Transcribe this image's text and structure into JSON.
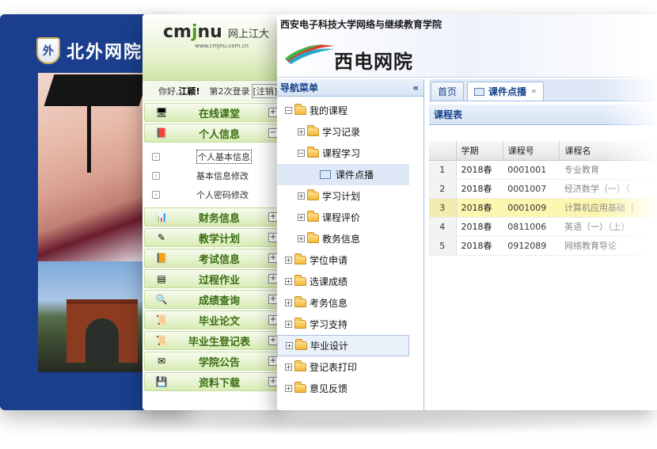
{
  "bfsu": {
    "brand": "北外网院",
    "emblem": "外"
  },
  "cmjnu": {
    "logo_pre": "cm",
    "logo_j": "j",
    "logo_post": "nu",
    "tagline": "网上江大",
    "url": "www.cmjnu.com.cn",
    "welcome_prefix": "你好,",
    "user_name": "江颖!",
    "login_count": "第2次登录",
    "logout": "[注销]",
    "menu": [
      {
        "label": "在线课堂",
        "icon": "monitor-icon",
        "toggle": "+"
      },
      {
        "label": "个人信息",
        "icon": "book-icon",
        "toggle": "−"
      },
      {
        "label": "财务信息",
        "icon": "bar-chart-icon",
        "toggle": "+"
      },
      {
        "label": "教学计划",
        "icon": "pencil-icon",
        "toggle": "+"
      },
      {
        "label": "考试信息",
        "icon": "notebook-icon",
        "toggle": "+"
      },
      {
        "label": "过程作业",
        "icon": "table-icon",
        "toggle": "+"
      },
      {
        "label": "成绩查询",
        "icon": "magnifier-icon",
        "toggle": "+"
      },
      {
        "label": "毕业论文",
        "icon": "scroll-icon",
        "toggle": "+"
      },
      {
        "label": "毕业生登记表",
        "icon": "scroll-icon",
        "toggle": "+"
      },
      {
        "label": "学院公告",
        "icon": "mail-icon",
        "toggle": "+"
      },
      {
        "label": "资料下载",
        "icon": "floppy-icon",
        "toggle": "+"
      }
    ],
    "submenu": [
      "个人基本信息",
      "基本信息修改",
      "个人密码修改"
    ]
  },
  "xidian": {
    "school": "西安电子科技大学网络与继续教育学院",
    "name": "西电网院",
    "nav_title": "导航菜单",
    "collapse": "«",
    "tree": [
      {
        "label": "我的课程",
        "level": 0,
        "toggle": "−",
        "type": "folder"
      },
      {
        "label": "学习记录",
        "level": 1,
        "toggle": "+",
        "type": "folder"
      },
      {
        "label": "课程学习",
        "level": 1,
        "toggle": "−",
        "type": "folder"
      },
      {
        "label": "课件点播",
        "level": 2,
        "toggle": "",
        "type": "doc"
      },
      {
        "label": "学习计划",
        "level": 1,
        "toggle": "+",
        "type": "folder"
      },
      {
        "label": "课程评价",
        "level": 1,
        "toggle": "+",
        "type": "folder"
      },
      {
        "label": "教务信息",
        "level": 1,
        "toggle": "+",
        "type": "folder"
      },
      {
        "label": "学位申请",
        "level": 0,
        "toggle": "+",
        "type": "folder"
      },
      {
        "label": "选课成绩",
        "level": 0,
        "toggle": "+",
        "type": "folder"
      },
      {
        "label": "考务信息",
        "level": 0,
        "toggle": "+",
        "type": "folder"
      },
      {
        "label": "学习支持",
        "level": 0,
        "toggle": "+",
        "type": "folder"
      },
      {
        "label": "毕业设计",
        "level": 0,
        "toggle": "+",
        "type": "folder"
      },
      {
        "label": "登记表打印",
        "level": 0,
        "toggle": "+",
        "type": "folder"
      },
      {
        "label": "意见反馈",
        "level": 0,
        "toggle": "+",
        "type": "folder"
      }
    ],
    "tabs": {
      "home": "首页",
      "courseware": "课件点播",
      "close": "✕"
    },
    "panel_title": "课程表",
    "columns": [
      "学期",
      "课程号",
      "课程名"
    ],
    "rows": [
      {
        "idx": "1",
        "term": "2018春",
        "code": "0001001",
        "name": "专业教育"
      },
      {
        "idx": "2",
        "term": "2018春",
        "code": "0001007",
        "name": "经济数学（一）（"
      },
      {
        "idx": "3",
        "term": "2018春",
        "code": "0001009",
        "name": "计算机应用基础（"
      },
      {
        "idx": "4",
        "term": "2018春",
        "code": "0811006",
        "name": "英语（一）（上）"
      },
      {
        "idx": "5",
        "term": "2018春",
        "code": "0912089",
        "name": "网络教育导论"
      }
    ]
  }
}
